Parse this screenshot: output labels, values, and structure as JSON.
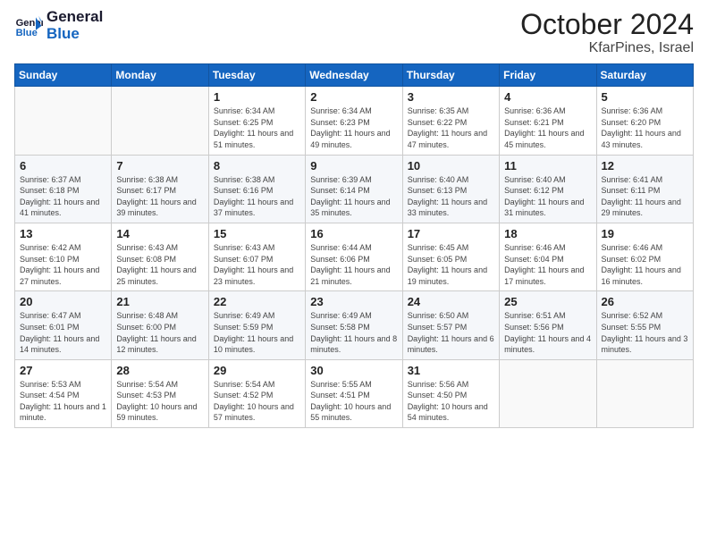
{
  "header": {
    "logo_line1": "General",
    "logo_line2": "Blue",
    "month": "October 2024",
    "location": "KfarPines, Israel"
  },
  "weekdays": [
    "Sunday",
    "Monday",
    "Tuesday",
    "Wednesday",
    "Thursday",
    "Friday",
    "Saturday"
  ],
  "weeks": [
    [
      {
        "day": "",
        "info": ""
      },
      {
        "day": "",
        "info": ""
      },
      {
        "day": "1",
        "info": "Sunrise: 6:34 AM\nSunset: 6:25 PM\nDaylight: 11 hours and 51 minutes."
      },
      {
        "day": "2",
        "info": "Sunrise: 6:34 AM\nSunset: 6:23 PM\nDaylight: 11 hours and 49 minutes."
      },
      {
        "day": "3",
        "info": "Sunrise: 6:35 AM\nSunset: 6:22 PM\nDaylight: 11 hours and 47 minutes."
      },
      {
        "day": "4",
        "info": "Sunrise: 6:36 AM\nSunset: 6:21 PM\nDaylight: 11 hours and 45 minutes."
      },
      {
        "day": "5",
        "info": "Sunrise: 6:36 AM\nSunset: 6:20 PM\nDaylight: 11 hours and 43 minutes."
      }
    ],
    [
      {
        "day": "6",
        "info": "Sunrise: 6:37 AM\nSunset: 6:18 PM\nDaylight: 11 hours and 41 minutes."
      },
      {
        "day": "7",
        "info": "Sunrise: 6:38 AM\nSunset: 6:17 PM\nDaylight: 11 hours and 39 minutes."
      },
      {
        "day": "8",
        "info": "Sunrise: 6:38 AM\nSunset: 6:16 PM\nDaylight: 11 hours and 37 minutes."
      },
      {
        "day": "9",
        "info": "Sunrise: 6:39 AM\nSunset: 6:14 PM\nDaylight: 11 hours and 35 minutes."
      },
      {
        "day": "10",
        "info": "Sunrise: 6:40 AM\nSunset: 6:13 PM\nDaylight: 11 hours and 33 minutes."
      },
      {
        "day": "11",
        "info": "Sunrise: 6:40 AM\nSunset: 6:12 PM\nDaylight: 11 hours and 31 minutes."
      },
      {
        "day": "12",
        "info": "Sunrise: 6:41 AM\nSunset: 6:11 PM\nDaylight: 11 hours and 29 minutes."
      }
    ],
    [
      {
        "day": "13",
        "info": "Sunrise: 6:42 AM\nSunset: 6:10 PM\nDaylight: 11 hours and 27 minutes."
      },
      {
        "day": "14",
        "info": "Sunrise: 6:43 AM\nSunset: 6:08 PM\nDaylight: 11 hours and 25 minutes."
      },
      {
        "day": "15",
        "info": "Sunrise: 6:43 AM\nSunset: 6:07 PM\nDaylight: 11 hours and 23 minutes."
      },
      {
        "day": "16",
        "info": "Sunrise: 6:44 AM\nSunset: 6:06 PM\nDaylight: 11 hours and 21 minutes."
      },
      {
        "day": "17",
        "info": "Sunrise: 6:45 AM\nSunset: 6:05 PM\nDaylight: 11 hours and 19 minutes."
      },
      {
        "day": "18",
        "info": "Sunrise: 6:46 AM\nSunset: 6:04 PM\nDaylight: 11 hours and 17 minutes."
      },
      {
        "day": "19",
        "info": "Sunrise: 6:46 AM\nSunset: 6:02 PM\nDaylight: 11 hours and 16 minutes."
      }
    ],
    [
      {
        "day": "20",
        "info": "Sunrise: 6:47 AM\nSunset: 6:01 PM\nDaylight: 11 hours and 14 minutes."
      },
      {
        "day": "21",
        "info": "Sunrise: 6:48 AM\nSunset: 6:00 PM\nDaylight: 11 hours and 12 minutes."
      },
      {
        "day": "22",
        "info": "Sunrise: 6:49 AM\nSunset: 5:59 PM\nDaylight: 11 hours and 10 minutes."
      },
      {
        "day": "23",
        "info": "Sunrise: 6:49 AM\nSunset: 5:58 PM\nDaylight: 11 hours and 8 minutes."
      },
      {
        "day": "24",
        "info": "Sunrise: 6:50 AM\nSunset: 5:57 PM\nDaylight: 11 hours and 6 minutes."
      },
      {
        "day": "25",
        "info": "Sunrise: 6:51 AM\nSunset: 5:56 PM\nDaylight: 11 hours and 4 minutes."
      },
      {
        "day": "26",
        "info": "Sunrise: 6:52 AM\nSunset: 5:55 PM\nDaylight: 11 hours and 3 minutes."
      }
    ],
    [
      {
        "day": "27",
        "info": "Sunrise: 5:53 AM\nSunset: 4:54 PM\nDaylight: 11 hours and 1 minute."
      },
      {
        "day": "28",
        "info": "Sunrise: 5:54 AM\nSunset: 4:53 PM\nDaylight: 10 hours and 59 minutes."
      },
      {
        "day": "29",
        "info": "Sunrise: 5:54 AM\nSunset: 4:52 PM\nDaylight: 10 hours and 57 minutes."
      },
      {
        "day": "30",
        "info": "Sunrise: 5:55 AM\nSunset: 4:51 PM\nDaylight: 10 hours and 55 minutes."
      },
      {
        "day": "31",
        "info": "Sunrise: 5:56 AM\nSunset: 4:50 PM\nDaylight: 10 hours and 54 minutes."
      },
      {
        "day": "",
        "info": ""
      },
      {
        "day": "",
        "info": ""
      }
    ]
  ]
}
